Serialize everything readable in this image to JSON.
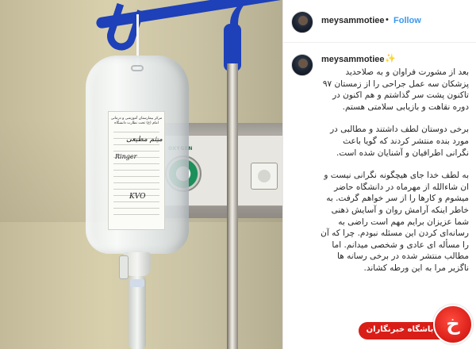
{
  "post": {
    "username": "meysammotiee",
    "separator": "•",
    "follow_label": "Follow"
  },
  "photo": {
    "bag_label_title": "مرکز بیمارستان آموزشی و درمانی امام (ع) تحت نظارت دانشگاه",
    "handwriting_name": "میثم مطیعی",
    "handwriting_drug": "Ringer",
    "handwriting_volume": "KVO",
    "oxygen_label": "OXYGEN"
  },
  "comment": {
    "username": "meysammotiee",
    "emoji": "✨",
    "paragraphs": [
      "بعد از مشورت فراوان و به صلاحدید پزشکان سه عمل جراحی را از زمستان ۹۷ تاکنون پشت سر گذاشتم و هم اکنون در دوره نقاهت و بازیابی سلامتی هستم.",
      "برخی دوستان لطف داشتند و مطالبی در مورد بنده منتشر کردند که گویا باعث نگرانی اطرافیان و آشنایان شده است.",
      "به لطف خدا جای هیچگونه نگرانی نیست و ان شاءالله از مهرماه در دانشگاه حاضر میشوم و کارها را از سر خواهم گرفت. به خاطر اینکه آرامش روان و آسایش ذهنی شما عزیزان برایم مهم است راضی به رسانه‌ای کردن این مسئله نبودم. چرا که آن را مسأله ای عادی و شخصی میدانم. اما مطالب منتشر شده در برخی رسانه ها ناگزیر مرا به این ورطه کشاند."
    ]
  },
  "watermark": {
    "logo_glyph": "خ",
    "text": "باشگاه خبرنگاران"
  },
  "colors": {
    "follow_blue": "#3897f0",
    "hook_blue": "#1e40b8",
    "badge_red": "#d91e18"
  },
  "icons": [
    "avatar",
    "hook-icon",
    "oxygen-dial-icon",
    "badge-logo-icon"
  ]
}
